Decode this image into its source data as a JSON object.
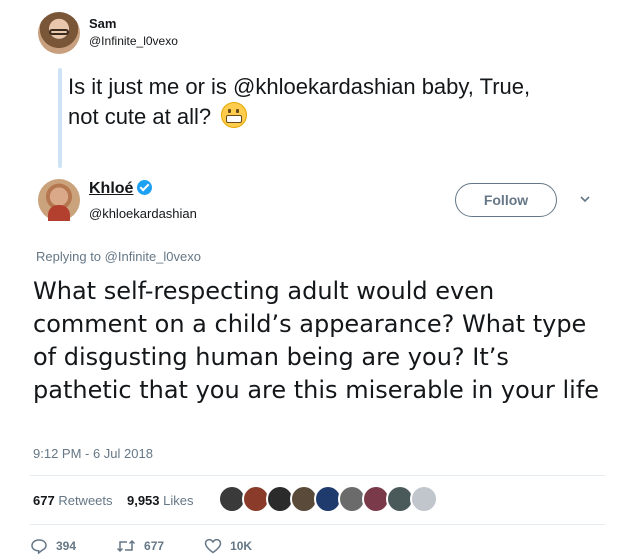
{
  "quoted": {
    "name": "Sam",
    "handle": "@Infinite_l0vexo",
    "text": "Is it just me or is @khloekardashian baby, True, not cute at all?"
  },
  "tweet": {
    "name": "Khloé",
    "handle": "@khloekardashian",
    "follow_label": "Follow",
    "replying_prefix": "Replying to",
    "replying_to": "@Infinite_l0vexo",
    "text": "What self-respecting adult would even comment on a child’s appearance? What type of disgusting human being are you? It’s pathetic that you are this miserable in your life",
    "timestamp": "9:12 PM - 6 Jul 2018"
  },
  "stats": {
    "retweets_count": "677",
    "retweets_label": "Retweets",
    "likes_count": "9,953",
    "likes_label": "Likes"
  },
  "actions": {
    "replies": "394",
    "retweets": "677",
    "likes": "10K"
  },
  "colors": {
    "accent": "#1da1f2",
    "muted": "#657786",
    "thread_line": "#cfe3f6"
  },
  "likers": [
    "#3a3a3a",
    "#8a3b2a",
    "#2b2b2b",
    "#5a4a3a",
    "#1f3b6e",
    "#6b6b6b",
    "#7a3a4a",
    "#4a5a5a",
    "#c0c6cc"
  ]
}
